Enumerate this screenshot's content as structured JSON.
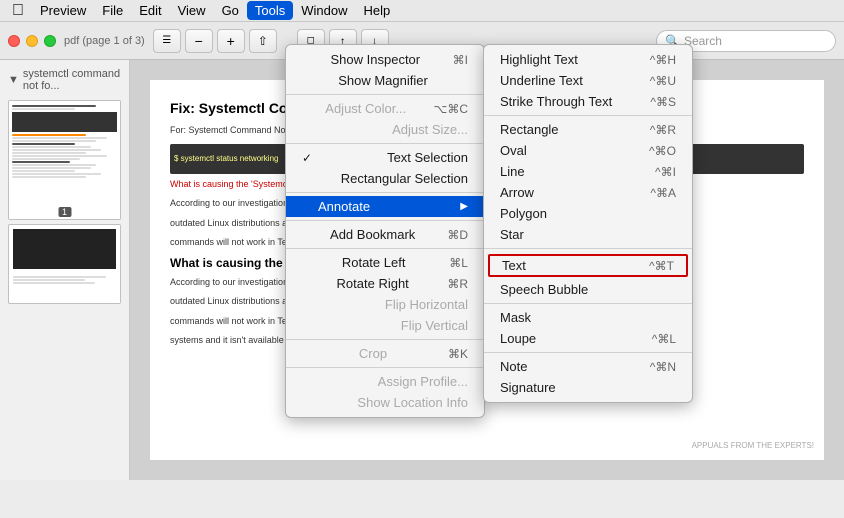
{
  "app": {
    "name": "Preview",
    "title": "Preview"
  },
  "menubar": {
    "apple": "⌘",
    "items": [
      {
        "label": "Preview",
        "active": false
      },
      {
        "label": "File",
        "active": false
      },
      {
        "label": "Edit",
        "active": false
      },
      {
        "label": "View",
        "active": false
      },
      {
        "label": "Go",
        "active": false
      },
      {
        "label": "Tools",
        "active": true
      },
      {
        "label": "Window",
        "active": false
      },
      {
        "label": "Help",
        "active": false
      }
    ]
  },
  "toolbar": {
    "search_placeholder": "Search",
    "doc_info": "pdf (page 1 of 3)"
  },
  "sidebar": {
    "header": "systemctl command not fo...",
    "page_number": "1"
  },
  "tools_menu": {
    "items": [
      {
        "id": "show-inspector",
        "label": "Show Inspector",
        "shortcut": "⌘I",
        "disabled": false,
        "check": ""
      },
      {
        "id": "show-magnifier",
        "label": "Show Magnifier",
        "shortcut": "",
        "disabled": false,
        "check": ""
      },
      {
        "id": "sep1",
        "type": "separator"
      },
      {
        "id": "adjust-color",
        "label": "Adjust Color...",
        "shortcut": "⌥⌘C",
        "disabled": true,
        "check": ""
      },
      {
        "id": "adjust-size",
        "label": "Adjust Size...",
        "shortcut": "",
        "disabled": true,
        "check": ""
      },
      {
        "id": "sep2",
        "type": "separator"
      },
      {
        "id": "text-selection",
        "label": "Text Selection",
        "shortcut": "",
        "disabled": false,
        "check": "✓"
      },
      {
        "id": "rectangular-selection",
        "label": "Rectangular Selection",
        "shortcut": "",
        "disabled": false,
        "check": ""
      },
      {
        "id": "sep3",
        "type": "separator"
      },
      {
        "id": "annotate",
        "label": "Annotate",
        "shortcut": "",
        "disabled": false,
        "check": "",
        "highlighted": true,
        "has_submenu": true
      },
      {
        "id": "sep4",
        "type": "separator"
      },
      {
        "id": "add-bookmark",
        "label": "Add Bookmark",
        "shortcut": "⌘D",
        "disabled": false,
        "check": ""
      },
      {
        "id": "sep5",
        "type": "separator"
      },
      {
        "id": "rotate-left",
        "label": "Rotate Left",
        "shortcut": "⌘L",
        "disabled": false,
        "check": ""
      },
      {
        "id": "rotate-right",
        "label": "Rotate Right",
        "shortcut": "⌘R",
        "disabled": false,
        "check": ""
      },
      {
        "id": "flip-horizontal",
        "label": "Flip Horizontal",
        "shortcut": "",
        "disabled": false,
        "check": ""
      },
      {
        "id": "flip-vertical",
        "label": "Flip Vertical",
        "shortcut": "",
        "disabled": false,
        "check": ""
      },
      {
        "id": "sep6",
        "type": "separator"
      },
      {
        "id": "crop",
        "label": "Crop",
        "shortcut": "⌘K",
        "disabled": true,
        "check": ""
      },
      {
        "id": "sep7",
        "type": "separator"
      },
      {
        "id": "assign-profile",
        "label": "Assign Profile...",
        "shortcut": "",
        "disabled": true,
        "check": ""
      },
      {
        "id": "show-location-info",
        "label": "Show Location Info",
        "shortcut": "",
        "disabled": true,
        "check": ""
      }
    ]
  },
  "annotate_submenu": {
    "items": [
      {
        "id": "highlight-text",
        "label": "Highlight Text",
        "shortcut": "^⌘H",
        "disabled": false
      },
      {
        "id": "underline-text",
        "label": "Underline Text",
        "shortcut": "^⌘U",
        "disabled": false
      },
      {
        "id": "strike-through",
        "label": "Strike Through Text",
        "shortcut": "^⌘S",
        "disabled": false
      },
      {
        "id": "sep1",
        "type": "separator"
      },
      {
        "id": "rectangle",
        "label": "Rectangle",
        "shortcut": "^⌘R",
        "disabled": false
      },
      {
        "id": "oval",
        "label": "Oval",
        "shortcut": "^⌘O",
        "disabled": false
      },
      {
        "id": "line",
        "label": "Line",
        "shortcut": "^⌘I",
        "disabled": false
      },
      {
        "id": "arrow",
        "label": "Arrow",
        "shortcut": "^⌘A",
        "disabled": false
      },
      {
        "id": "polygon",
        "label": "Polygon",
        "shortcut": "",
        "disabled": false
      },
      {
        "id": "star",
        "label": "Star",
        "shortcut": "",
        "disabled": false
      },
      {
        "id": "sep2",
        "type": "separator"
      },
      {
        "id": "text",
        "label": "Text",
        "shortcut": "^⌘T",
        "disabled": false,
        "highlighted": true
      },
      {
        "id": "speech-bubble",
        "label": "Speech Bubble",
        "shortcut": "",
        "disabled": false
      },
      {
        "id": "sep3",
        "type": "separator"
      },
      {
        "id": "mask",
        "label": "Mask",
        "shortcut": "",
        "disabled": false
      },
      {
        "id": "loupe",
        "label": "Loupe",
        "shortcut": "^⌘L",
        "disabled": false
      },
      {
        "id": "sep4",
        "type": "separator"
      },
      {
        "id": "note",
        "label": "Note",
        "shortcut": "^⌘N",
        "disabled": false
      },
      {
        "id": "signature",
        "label": "Signature",
        "shortcut": "",
        "disabled": false
      }
    ]
  },
  "page_content": {
    "title": "Fix: Systemctl Command Not Found",
    "subtitle": "What is causing the 'Syster... error?",
    "body_text": "According to our investigations, the main cau...",
    "body_text2": "outdated Linux distributions are using SysV in...",
    "body_text3": "commands will not work in Terminal. Systen...",
    "body_text4": "systems and it isn't available for the outdated versions."
  }
}
